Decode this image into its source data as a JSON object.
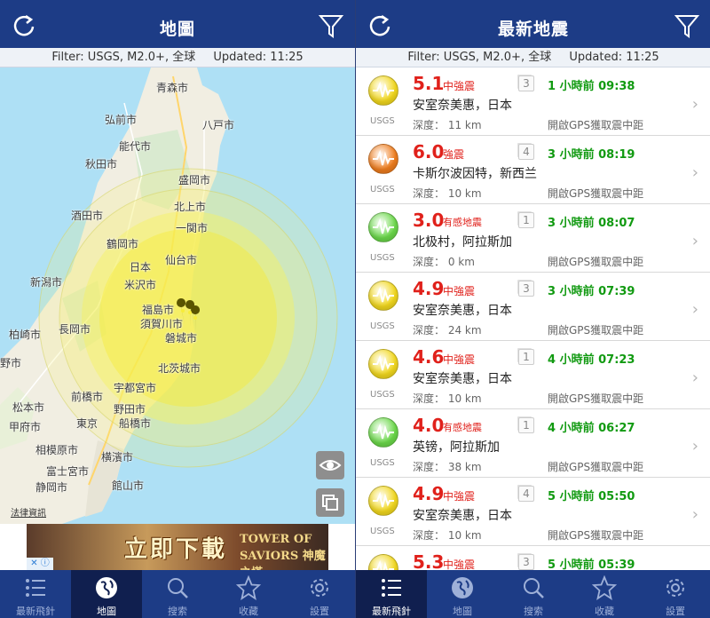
{
  "left": {
    "title": "地圖",
    "filter": {
      "text": "Filter: USGS, M2.0+, 全球",
      "updated": "Updated: 11:25"
    },
    "cities": [
      {
        "name": "青森市"
      },
      {
        "name": "弘前市"
      },
      {
        "name": "八戸市"
      },
      {
        "name": "能代市"
      },
      {
        "name": "秋田市"
      },
      {
        "name": "盛岡市"
      },
      {
        "name": "北上市"
      },
      {
        "name": "酒田市"
      },
      {
        "name": "一関市"
      },
      {
        "name": "鶴岡市"
      },
      {
        "name": "日本"
      },
      {
        "name": "仙台市"
      },
      {
        "name": "新潟市"
      },
      {
        "name": "米沢市"
      },
      {
        "name": "福島市"
      },
      {
        "name": "須賀川市"
      },
      {
        "name": "柏崎市"
      },
      {
        "name": "長岡市"
      },
      {
        "name": "磐城市"
      },
      {
        "name": "北茨城市"
      },
      {
        "name": "野市"
      },
      {
        "name": "松本市"
      },
      {
        "name": "宇都宮市"
      },
      {
        "name": "前橋市"
      },
      {
        "name": "野田市"
      },
      {
        "name": "東京"
      },
      {
        "name": "船橋市"
      },
      {
        "name": "甲府市"
      },
      {
        "name": "相模原市"
      },
      {
        "name": "横濱市"
      },
      {
        "name": "富士宮市"
      },
      {
        "name": "静岡市"
      },
      {
        "name": "館山市"
      }
    ],
    "legal": "法律資訊",
    "ad": {
      "headline": "立即下載",
      "brand": "TOWER OF SAVIORS 神魔之塔"
    }
  },
  "right": {
    "title": "最新地震",
    "filter": {
      "text": "Filter: USGS, M2.0+, 全球",
      "updated": "Updated: 11:25"
    },
    "quakes": [
      {
        "mag": "5.1",
        "intensity": "中強震",
        "level": "3",
        "time": "1 小時前 09:38",
        "place": "安室奈美惠，日本",
        "depth": "深度：  11 km",
        "gps": "開啟GPS獲取震中距",
        "src": "USGS",
        "color": "#f2d81e"
      },
      {
        "mag": "6.0",
        "intensity": "強震",
        "level": "4",
        "time": "3 小時前 08:19",
        "place": "卡斯尔波因特，新西兰",
        "depth": "深度：  10 km",
        "gps": "開啟GPS獲取震中距",
        "src": "USGS",
        "color": "#ef7d1e"
      },
      {
        "mag": "3.0",
        "intensity": "有感地震",
        "level": "1",
        "time": "3 小時前 08:07",
        "place": "北极村，阿拉斯加",
        "depth": "深度：   0 km",
        "gps": "開啟GPS獲取震中距",
        "src": "USGS",
        "color": "#6bd84a"
      },
      {
        "mag": "4.9",
        "intensity": "中強震",
        "level": "3",
        "time": "3 小時前 07:39",
        "place": "安室奈美惠，日本",
        "depth": "深度：  24 km",
        "gps": "開啟GPS獲取震中距",
        "src": "USGS",
        "color": "#f2d81e"
      },
      {
        "mag": "4.6",
        "intensity": "中強震",
        "level": "1",
        "time": "4 小時前 07:23",
        "place": "安室奈美惠，日本",
        "depth": "深度：  10 km",
        "gps": "開啟GPS獲取震中距",
        "src": "USGS",
        "color": "#f2d81e"
      },
      {
        "mag": "4.0",
        "intensity": "有感地震",
        "level": "1",
        "time": "4 小時前 06:27",
        "place": "英镑，阿拉斯加",
        "depth": "深度：  38 km",
        "gps": "開啟GPS獲取震中距",
        "src": "USGS",
        "color": "#6bd84a"
      },
      {
        "mag": "4.9",
        "intensity": "中強震",
        "level": "4",
        "time": "5 小時前 05:50",
        "place": "安室奈美惠，日本",
        "depth": "深度：  10 km",
        "gps": "開啟GPS獲取震中距",
        "src": "USGS",
        "color": "#f2d81e"
      },
      {
        "mag": "5.3",
        "intensity": "中強震",
        "level": "3",
        "time": "5 小時前 05:39",
        "place": "",
        "depth": "",
        "gps": "",
        "src": "",
        "color": "#f2d81e"
      }
    ]
  },
  "tabs": [
    {
      "label": "最新飛針",
      "icon": "list-icon"
    },
    {
      "label": "地圖",
      "icon": "globe-icon"
    },
    {
      "label": "搜索",
      "icon": "search-icon"
    },
    {
      "label": "收藏",
      "icon": "star-icon"
    },
    {
      "label": "設置",
      "icon": "gear-icon"
    }
  ],
  "colors": {
    "navbar": "#1d3c86",
    "tab_active": "#101f4f",
    "mag_red": "#e0211b",
    "time_green": "#119a11"
  }
}
